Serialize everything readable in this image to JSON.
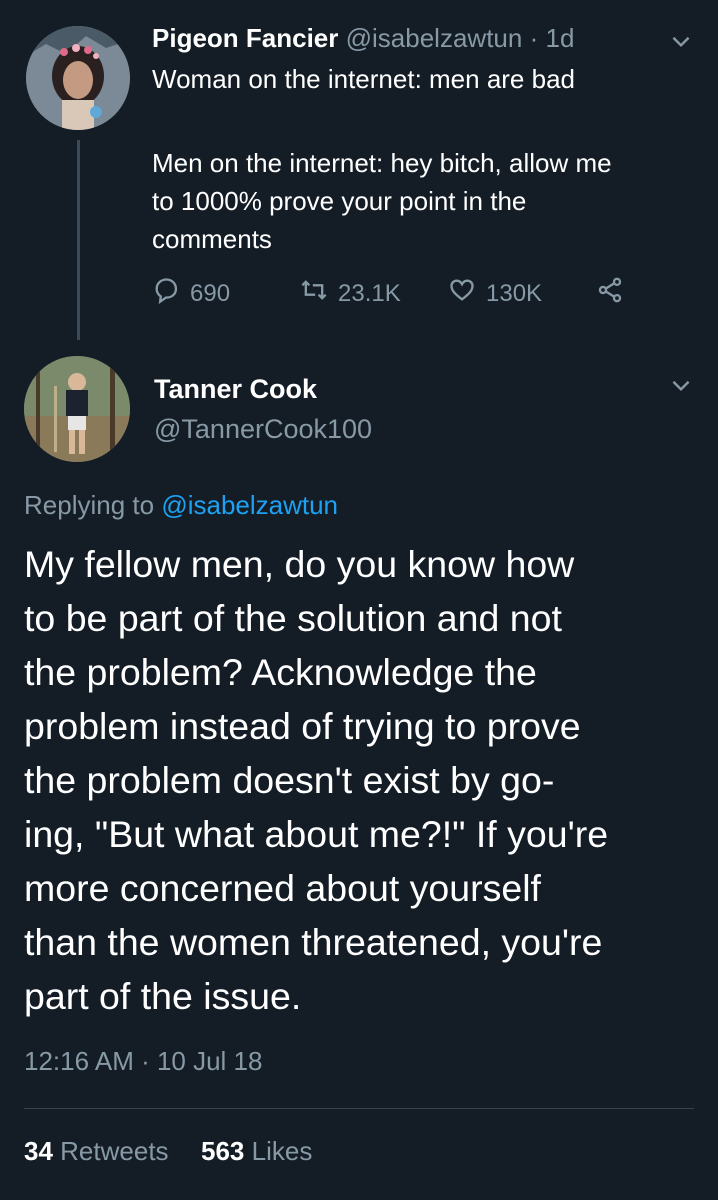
{
  "quoted_tweet": {
    "display_name": "Pigeon Fancier",
    "handle": "@isabelzawtun",
    "separator": "·",
    "time_ago": "1d",
    "text_line1": "Woman on the internet: men are bad",
    "text_line2": "Men on the internet: hey bitch, allow me",
    "text_line3": "to 1000% prove your point in the",
    "text_line4": "comments",
    "reply_count": "690",
    "retweet_count": "23.1K",
    "like_count": "130K",
    "icons": {
      "reply": "reply-icon",
      "retweet": "retweet-icon",
      "like": "heart-icon",
      "share": "share-icon",
      "menu": "chevron-down-icon"
    }
  },
  "main_tweet": {
    "display_name": "Tanner Cook",
    "handle": "@TannerCook100",
    "replying_prefix": "Replying to",
    "replying_to": "@isabelzawtun",
    "lines": [
      "My fellow men, do you know how",
      "to be part of the solution and not",
      "the problem? Acknowledge the",
      "problem instead of trying to prove",
      "the problem doesn't exist by go-",
      "ing, \"But what about me?!\" If you're",
      "more concerned about yourself",
      "than the women threatened, you're",
      "part of the issue."
    ],
    "timestamp": "12:16 AM · 10 Jul 18",
    "retweets_count": "34",
    "retweets_label": "Retweets",
    "likes_count": "563",
    "likes_label": "Likes"
  },
  "colors": {
    "background": "#141d26",
    "text": "#ffffff",
    "muted": "#8899a6",
    "link": "#1da1f2",
    "divider": "#38444d"
  }
}
